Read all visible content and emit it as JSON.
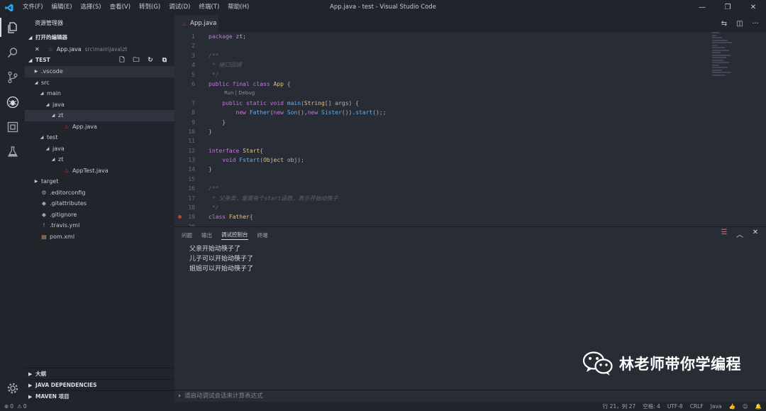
{
  "window": {
    "title": "App.java - test - Visual Studio Code",
    "menu": [
      "文件(F)",
      "编辑(E)",
      "选择(S)",
      "查看(V)",
      "转到(G)",
      "调试(D)",
      "终端(T)",
      "帮助(H)"
    ],
    "accent": "#23a7f2"
  },
  "activity": [
    "files-icon",
    "search-icon",
    "source-control-icon",
    "debug-icon",
    "extensions-icon",
    "test-icon",
    "settings-icon"
  ],
  "sidebar": {
    "title": "资源管理器",
    "open_editors": {
      "label": "打开的编辑器",
      "items": [
        {
          "name": "App.java",
          "path": "src\\main\\java\\zt"
        }
      ]
    },
    "project": {
      "label": "TEST",
      "tree": [
        {
          "label": ".vscode",
          "twisty": "▶",
          "icon": "",
          "indent": 0
        },
        {
          "label": "src",
          "twisty": "◢",
          "icon": "",
          "indent": 0
        },
        {
          "label": "main",
          "twisty": "◢",
          "icon": "",
          "indent": 1
        },
        {
          "label": "java",
          "twisty": "◢",
          "icon": "",
          "indent": 2
        },
        {
          "label": "zt",
          "twisty": "◢",
          "icon": "",
          "indent": 3
        },
        {
          "label": "App.java",
          "twisty": "",
          "icon": "java",
          "indent": 4
        },
        {
          "label": "test",
          "twisty": "◢",
          "icon": "",
          "indent": 1
        },
        {
          "label": "java",
          "twisty": "◢",
          "icon": "",
          "indent": 2
        },
        {
          "label": "zt",
          "twisty": "◢",
          "icon": "",
          "indent": 3
        },
        {
          "label": "AppTest.java",
          "twisty": "",
          "icon": "java",
          "indent": 4
        },
        {
          "label": "target",
          "twisty": "▶",
          "icon": "",
          "indent": 0
        },
        {
          "label": ".editorconfig",
          "twisty": "",
          "icon": "gear",
          "indent": 0
        },
        {
          "label": ".gitattributes",
          "twisty": "",
          "icon": "git",
          "indent": 0
        },
        {
          "label": ".gitignore",
          "twisty": "",
          "icon": "git",
          "indent": 0
        },
        {
          "label": ".travis.yml",
          "twisty": "",
          "icon": "yml",
          "indent": 0
        },
        {
          "label": "pom.xml",
          "twisty": "",
          "icon": "xml",
          "indent": 0
        }
      ]
    },
    "bottom_sections": [
      "大纲",
      "JAVA DEPENDENCIES",
      "MAVEN 项目"
    ]
  },
  "editor": {
    "tab": "App.java",
    "code_lens": "Run | Debug"
  },
  "panel": {
    "tabs": [
      "问题",
      "输出",
      "调试控制台",
      "终端"
    ],
    "active_tab": "调试控制台",
    "output": [
      "父亲开始动筷子了",
      "儿子可以开始动筷子了",
      "姐姐可以开始动筷子了"
    ],
    "repl_placeholder": "请启动调试会话来计算表达式"
  },
  "watermark": "林老师带你学编程",
  "status": {
    "errors": "0",
    "warnings": "0",
    "position": "行 21，列 27",
    "spaces": "空格: 4",
    "encoding": "UTF-8",
    "eol": "CRLF",
    "language": "Java"
  }
}
